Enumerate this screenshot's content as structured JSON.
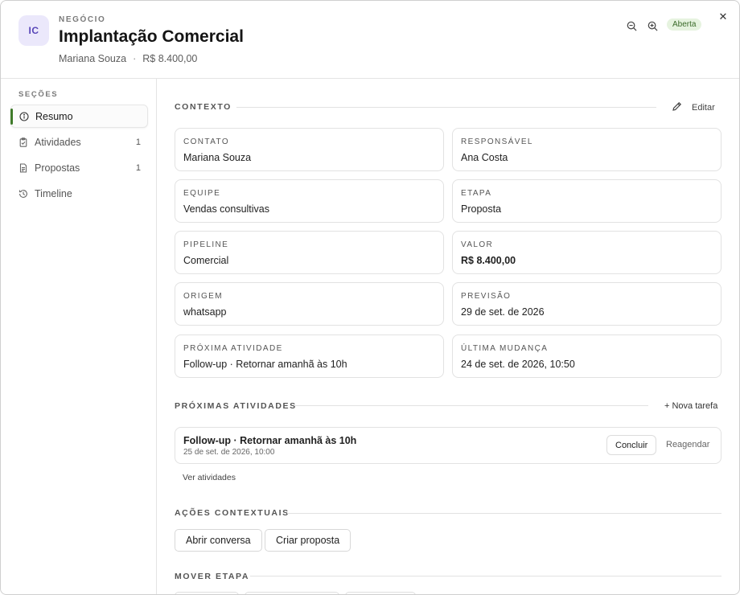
{
  "header": {
    "avatar_initials": "IC",
    "kicker": "NEGÓCIO",
    "title": "Implantação Comercial",
    "contact": "Mariana Souza",
    "separator": "·",
    "value": "R$ 8.400,00",
    "status_badge": "Aberta",
    "close_glyph": "✕",
    "icons": {
      "zoom_out": "zoom-out-icon",
      "zoom_in": "zoom-in-icon",
      "close": "close-icon"
    },
    "badge_color": "#e6f3df"
  },
  "sidebar": {
    "heading": "SEÇÕES",
    "items": [
      {
        "label": "Resumo",
        "count": "",
        "icon": "info-icon",
        "active": true
      },
      {
        "label": "Atividades",
        "count": "1",
        "icon": "clipboard-icon",
        "active": false
      },
      {
        "label": "Propostas",
        "count": "1",
        "icon": "document-icon",
        "active": false
      },
      {
        "label": "Timeline",
        "count": "",
        "icon": "history-icon",
        "active": false
      }
    ],
    "accent_color": "#3f7a2a"
  },
  "context": {
    "title": "CONTEXTO",
    "edit_label": "Editar",
    "fields": [
      {
        "label": "CONTATO",
        "value": "Mariana Souza"
      },
      {
        "label": "RESPONSÁVEL",
        "value": "Ana Costa"
      },
      {
        "label": "EQUIPE",
        "value": "Vendas consultivas"
      },
      {
        "label": "ETAPA",
        "value": "Proposta"
      },
      {
        "label": "PIPELINE",
        "value": "Comercial"
      },
      {
        "label": "VALOR",
        "value": "R$ 8.400,00"
      },
      {
        "label": "ORIGEM",
        "value": "whatsapp"
      },
      {
        "label": "PREVISÃO",
        "value": "29 de set. de 2026"
      },
      {
        "label": "PRÓXIMA ATIVIDADE",
        "value": "Follow-up · Retornar amanhã às 10h"
      },
      {
        "label": "ÚLTIMA MUDANÇA",
        "value": "24 de set. de 2026, 10:50"
      }
    ]
  },
  "activities": {
    "title": "PRÓXIMAS ATIVIDADES",
    "new_task_label": "+ Nova tarefa",
    "items": [
      {
        "title": "Follow-up · Retornar amanhã às 10h",
        "date": "25 de set. de 2026, 10:00",
        "done_label": "Concluir",
        "reschedule_label": "Reagendar"
      }
    ],
    "see_all_label": "Ver atividades"
  },
  "actions": {
    "title": "AÇÕES CONTEXTUAIS",
    "buttons": [
      "Abrir conversa",
      "Criar proposta"
    ]
  },
  "stage": {
    "title": "MOVER ETAPA"
  }
}
